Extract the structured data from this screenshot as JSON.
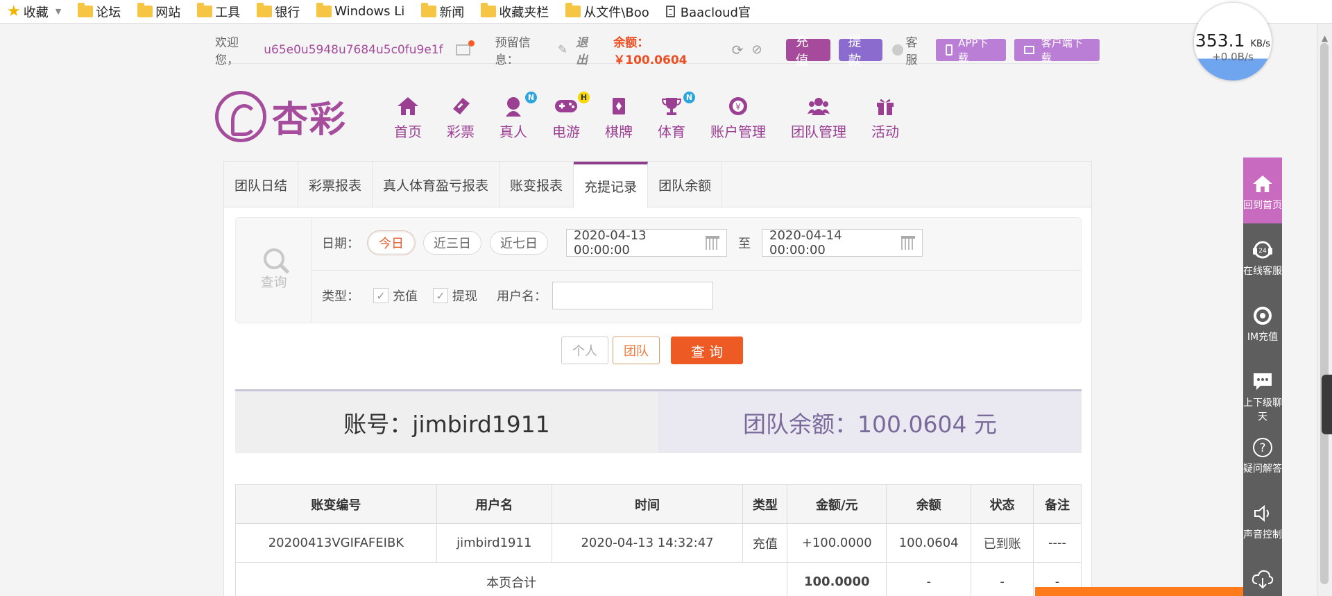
{
  "bookmarks": [
    {
      "label": "收藏",
      "type": "star"
    },
    {
      "label": "论坛",
      "type": "folder"
    },
    {
      "label": "网站",
      "type": "folder"
    },
    {
      "label": "工具",
      "type": "folder"
    },
    {
      "label": "银行",
      "type": "folder"
    },
    {
      "label": "Windows Li",
      "type": "folder"
    },
    {
      "label": "新闻",
      "type": "folder"
    },
    {
      "label": "收藏夹栏",
      "type": "folder"
    },
    {
      "label": "从文件\\Boo",
      "type": "folder"
    },
    {
      "label": "Baacloud官",
      "type": "doc"
    }
  ],
  "speed": {
    "value": "353.1",
    "unit": "KB/s",
    "sub": "+0.0B/s"
  },
  "topbar": {
    "welcome": "欢迎您，",
    "username": "u65e0u5948u7684u5c0fu9e1f",
    "notice_label": "预留信息：",
    "logout": "退出",
    "balance": "余额：￥100.0604",
    "recharge": "充值",
    "withdraw": "提款",
    "service": "客服",
    "app_download": "APP下载",
    "client_download": "客户端下载"
  },
  "logo": {
    "text": "杏彩"
  },
  "nav": [
    {
      "label": "首页",
      "icon": "home-icon"
    },
    {
      "label": "彩票",
      "icon": "lottery-icon"
    },
    {
      "label": "真人",
      "icon": "live-icon",
      "badge": "N"
    },
    {
      "label": "电游",
      "icon": "gamepad-icon",
      "badge": "H"
    },
    {
      "label": "棋牌",
      "icon": "cards-icon"
    },
    {
      "label": "体育",
      "icon": "trophy-icon",
      "badge": "N"
    },
    {
      "label": "账户管理",
      "icon": "account-icon"
    },
    {
      "label": "团队管理",
      "icon": "team-icon"
    },
    {
      "label": "活动",
      "icon": "gift-icon"
    }
  ],
  "tabs": [
    {
      "label": "团队日结"
    },
    {
      "label": "彩票报表"
    },
    {
      "label": "真人体育盈亏报表"
    },
    {
      "label": "账变报表"
    },
    {
      "label": "充提记录",
      "active": true
    },
    {
      "label": "团队余额"
    }
  ],
  "search": {
    "side_label": "查询",
    "date_label": "日期：",
    "quick": [
      "今日",
      "近三日",
      "近七日"
    ],
    "start": "2020-04-13 00:00:00",
    "to": "至",
    "end": "2020-04-14 00:00:00",
    "type_label": "类型：",
    "type_recharge": "充值",
    "type_withdraw": "提现",
    "user_label": "用户名：",
    "user_value": ""
  },
  "buttons": {
    "personal": "个人",
    "team": "团队",
    "query": "查 询"
  },
  "summary": {
    "account": "账号：jimbird1911",
    "team_balance": "团队余额：100.0604 元"
  },
  "table": {
    "headers": [
      "账变编号",
      "用户名",
      "时间",
      "类型",
      "金额/元",
      "余额",
      "状态",
      "备注"
    ],
    "rows": [
      [
        "20200413VGIFAFEIBK",
        "jimbird1911",
        "2020-04-13 14:32:47",
        "充值",
        "+100.0000",
        "100.0604",
        "已到账",
        "----"
      ]
    ],
    "total_label": "本页合计",
    "total": [
      "100.0000",
      "-",
      "-",
      "-"
    ]
  },
  "sidebar": [
    {
      "label": "回到首页",
      "icon": "home-icon",
      "active": true
    },
    {
      "label": "在线客服",
      "icon": "headset-icon"
    },
    {
      "label": "IM充值",
      "icon": "im-icon"
    },
    {
      "label": "上下级聊天",
      "icon": "chat-icon"
    },
    {
      "label": "疑问解答",
      "icon": "question-icon"
    },
    {
      "label": "声音控制",
      "icon": "speaker-icon"
    },
    {
      "label": "",
      "icon": "cloud-download-icon"
    }
  ],
  "colors": {
    "brand": "#a54c9c",
    "accent": "#ee5a23",
    "sidebar": "#5e5e5e",
    "sidebar_active": "#c86ac0"
  }
}
